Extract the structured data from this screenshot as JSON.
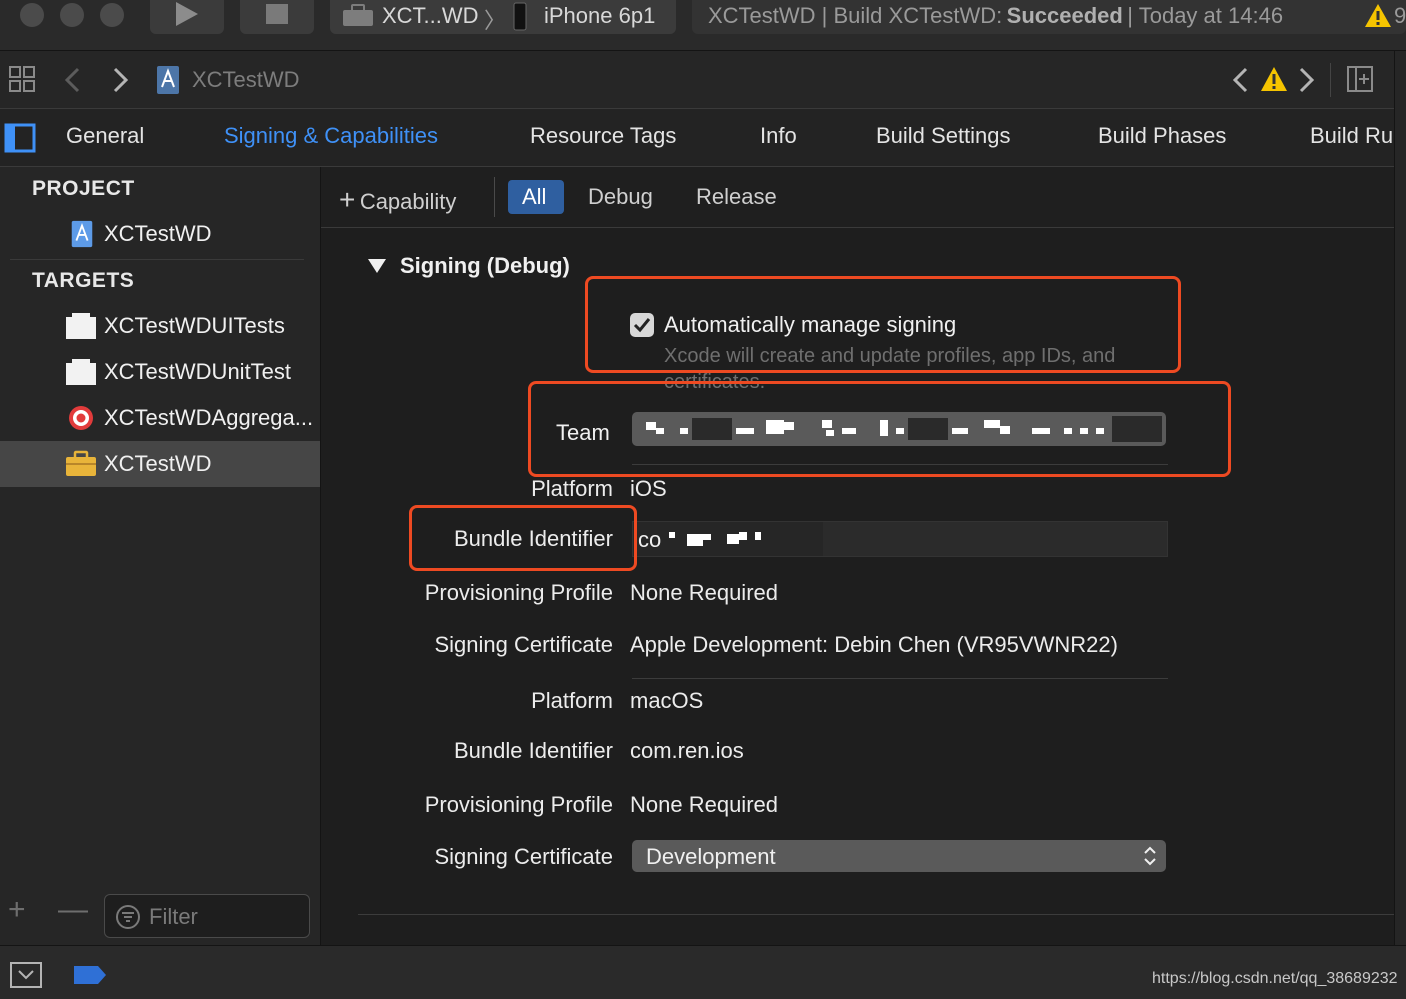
{
  "toolbar": {
    "scheme_name": "XCT...WD",
    "device_name": "iPhone 6p1",
    "status_prefix": "XCTestWD | Build XCTestWD:",
    "status_result": "Succeeded",
    "status_time": "| Today at 14:46",
    "warning_count": "9"
  },
  "navbar": {
    "breadcrumb_project": "XCTestWD"
  },
  "tabs": {
    "general": "General",
    "signing": "Signing & Capabilities",
    "resource_tags": "Resource Tags",
    "info": "Info",
    "build_settings": "Build Settings",
    "build_phases": "Build Phases",
    "build_rules": "Build Ru"
  },
  "sidebar": {
    "project_header": "PROJECT",
    "project_item": "XCTestWD",
    "targets_header": "TARGETS",
    "targets": [
      "XCTestWDUITests",
      "XCTestWDUnitTest",
      "XCTestWDAggrega...",
      "XCTestWD"
    ],
    "filter_placeholder": "Filter"
  },
  "filterbar": {
    "add_capability": "Capability",
    "all": "All",
    "debug": "Debug",
    "release": "Release"
  },
  "signing": {
    "section_title": "Signing (Debug)",
    "auto_manage_label": "Automatically manage signing",
    "auto_manage_help": "Xcode will create and update profiles, app IDs, and certificates.",
    "auto_manage_checked": true,
    "team_label": "Team",
    "ios": {
      "platform_label": "Platform",
      "platform_value": "iOS",
      "bundle_label": "Bundle Identifier",
      "bundle_value": "co",
      "profile_label": "Provisioning Profile",
      "profile_value": "None Required",
      "cert_label": "Signing Certificate",
      "cert_value": "Apple Development: Debin Chen (VR95VWNR22)"
    },
    "macos": {
      "platform_label": "Platform",
      "platform_value": "macOS",
      "bundle_label": "Bundle Identifier",
      "bundle_value": "com.ren.ios",
      "profile_label": "Provisioning Profile",
      "profile_value": "None Required",
      "cert_label": "Signing Certificate",
      "cert_value": "Development"
    }
  },
  "watermark": "https://blog.csdn.net/qq_38689232",
  "colors": {
    "accent": "#3f91f7",
    "highlight_box": "#ee4a22",
    "warning": "#f5c400",
    "target_icon": "#e23b3b"
  }
}
